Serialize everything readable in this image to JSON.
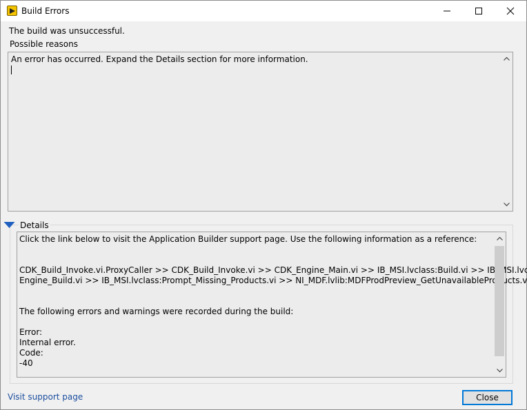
{
  "window": {
    "title": "Build Errors",
    "icon": "labview-run-icon"
  },
  "titlebar_buttons": {
    "minimize_icon": "minimize-icon",
    "maximize_icon": "maximize-icon",
    "close_icon": "close-icon"
  },
  "status": "The build was unsuccessful.",
  "reasons": {
    "label": "Possible reasons",
    "text": "An error has occurred. Expand the Details section for more information."
  },
  "details": {
    "label": "Details",
    "lines": [
      "Click the link below to visit the Application Builder support page. Use the following information as a reference:",
      "",
      "",
      "CDK_Build_Invoke.vi.ProxyCaller >> CDK_Build_Invoke.vi >> CDK_Engine_Main.vi >> IB_MSI.lvclass:Build.vi >> IB_MSI.lvclass:",
      "Engine_Build.vi >> IB_MSI.lvclass:Prompt_Missing_Products.vi >> NI_MDF.lvlib:MDFProdPreview_GetUnavailableProducts.vi",
      "",
      "",
      "The following errors and warnings were recorded during the build:",
      "",
      "Error:",
      "Internal error.",
      "Code:",
      "-40"
    ]
  },
  "footer": {
    "link": "Visit support page",
    "close_button": "Close"
  },
  "colors": {
    "link": "#1c4e9e",
    "accent": "#0078d7",
    "toggle": "#1f5fbf",
    "app_icon": "#f4c300"
  }
}
